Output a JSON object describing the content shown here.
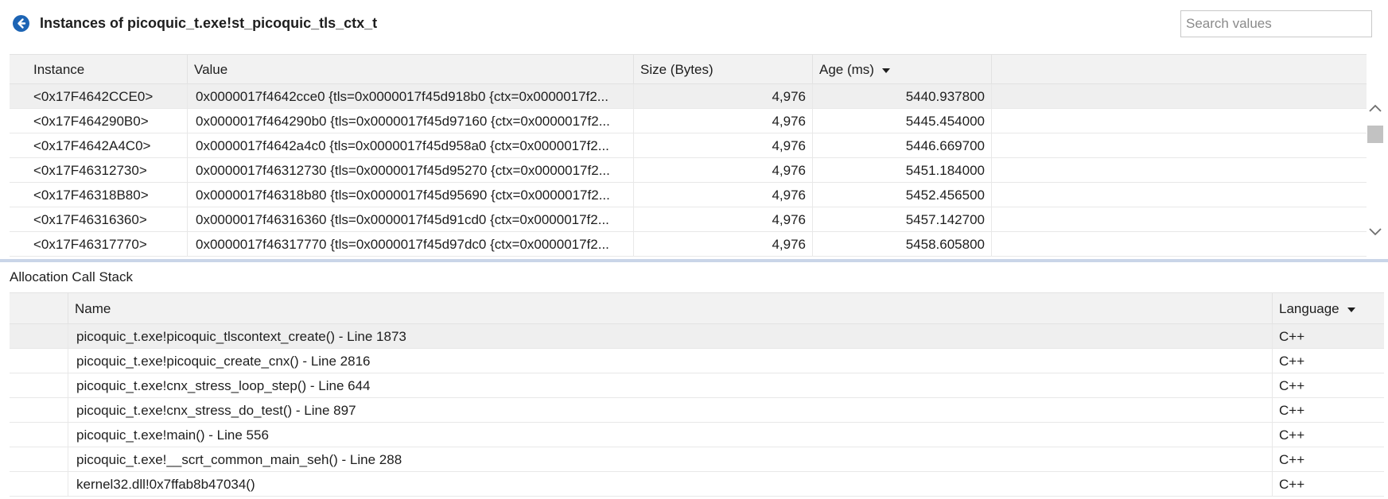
{
  "header": {
    "title": "Instances of picoquic_t.exe!st_picoquic_tls_ctx_t",
    "search_placeholder": "Search values"
  },
  "instances": {
    "columns": [
      "Instance",
      "Value",
      "Size (Bytes)",
      "Age (ms)"
    ],
    "sorted_column": "Age (ms)",
    "rows": [
      {
        "instance": "<0x17F4642CCE0>",
        "value": "0x0000017f4642cce0 {tls=0x0000017f45d918b0 {ctx=0x0000017f2...",
        "size": "4,976",
        "age": "5440.937800",
        "selected": true
      },
      {
        "instance": "<0x17F464290B0>",
        "value": "0x0000017f464290b0 {tls=0x0000017f45d97160 {ctx=0x0000017f2...",
        "size": "4,976",
        "age": "5445.454000",
        "selected": false
      },
      {
        "instance": "<0x17F4642A4C0>",
        "value": "0x0000017f4642a4c0 {tls=0x0000017f45d958a0 {ctx=0x0000017f2...",
        "size": "4,976",
        "age": "5446.669700",
        "selected": false
      },
      {
        "instance": "<0x17F46312730>",
        "value": "0x0000017f46312730 {tls=0x0000017f45d95270 {ctx=0x0000017f2...",
        "size": "4,976",
        "age": "5451.184000",
        "selected": false
      },
      {
        "instance": "<0x17F46318B80>",
        "value": "0x0000017f46318b80 {tls=0x0000017f45d95690 {ctx=0x0000017f2...",
        "size": "4,976",
        "age": "5452.456500",
        "selected": false
      },
      {
        "instance": "<0x17F46316360>",
        "value": "0x0000017f46316360 {tls=0x0000017f45d91cd0 {ctx=0x0000017f2...",
        "size": "4,976",
        "age": "5457.142700",
        "selected": false
      },
      {
        "instance": "<0x17F46317770>",
        "value": "0x0000017f46317770 {tls=0x0000017f45d97dc0 {ctx=0x0000017f2...",
        "size": "4,976",
        "age": "5458.605800",
        "selected": false
      }
    ]
  },
  "call_stack": {
    "title": "Allocation Call Stack",
    "columns": [
      "Name",
      "Language"
    ],
    "sorted_column": "Language",
    "rows": [
      {
        "name": "picoquic_t.exe!picoquic_tlscontext_create() - Line 1873",
        "language": "C++",
        "selected": true
      },
      {
        "name": "picoquic_t.exe!picoquic_create_cnx() - Line 2816",
        "language": "C++",
        "selected": false
      },
      {
        "name": "picoquic_t.exe!cnx_stress_loop_step() - Line 644",
        "language": "C++",
        "selected": false
      },
      {
        "name": "picoquic_t.exe!cnx_stress_do_test() - Line 897",
        "language": "C++",
        "selected": false
      },
      {
        "name": "picoquic_t.exe!main() - Line 556",
        "language": "C++",
        "selected": false
      },
      {
        "name": "picoquic_t.exe!__scrt_common_main_seh() - Line 288",
        "language": "C++",
        "selected": false
      },
      {
        "name": "kernel32.dll!0x7ffab8b47034()",
        "language": "C++",
        "selected": false
      }
    ]
  },
  "icons": {
    "back": "back-arrow-icon",
    "sort": "sort-descending-icon",
    "scroll_up": "chevron-up-icon",
    "scroll_down": "chevron-down-icon"
  },
  "colors": {
    "accent": "#1c64b4",
    "header_bg": "#f2f2f2",
    "selected_row": "#efefef",
    "splitter": "#c9d5e8"
  }
}
